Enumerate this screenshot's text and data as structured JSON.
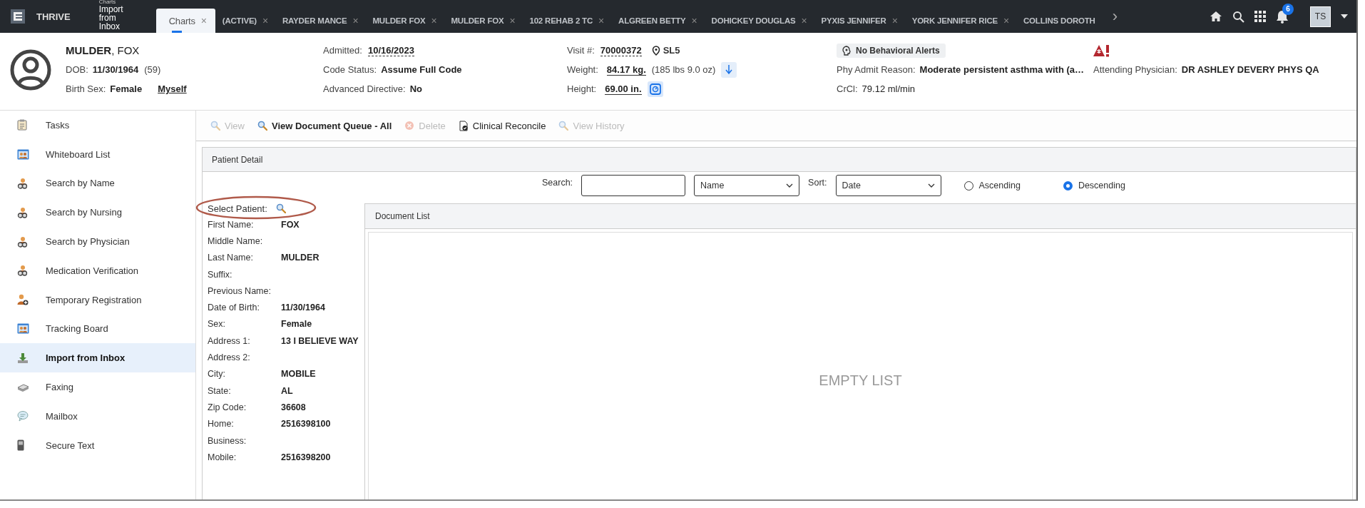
{
  "top_bar": {
    "product": "THRIVE",
    "context_label": "Charts",
    "context_title": "Import from Inbox",
    "tabs": [
      {
        "label": "Charts",
        "selected": true,
        "close": "×"
      },
      {
        "label": "(ACTIVE)",
        "selected": false,
        "close": "×"
      },
      {
        "label": "RAYDER MANCE",
        "selected": false,
        "close": "×"
      },
      {
        "label": "MULDER FOX",
        "selected": false,
        "close": "×"
      },
      {
        "label": "MULDER FOX",
        "selected": false,
        "close": "×"
      },
      {
        "label": "102 REHAB 2 TC",
        "selected": false,
        "close": "×"
      },
      {
        "label": "ALGREEN BETTY",
        "selected": false,
        "close": "×"
      },
      {
        "label": "DOHICKEY DOUGLAS",
        "selected": false,
        "close": "×"
      },
      {
        "label": "PYXIS JENNIFER",
        "selected": false,
        "close": "×"
      },
      {
        "label": "YORK JENNIFER RICE",
        "selected": false,
        "close": "×"
      },
      {
        "label": "COLLINS DOROTH",
        "selected": false
      }
    ],
    "scroll_arrow": "›",
    "notification_count": "6",
    "user_initials": "TS"
  },
  "patient_header": {
    "name": "**MULDER**, FOX",
    "columns": [
      [
        {
          "kind": "field",
          "label": "DOB:",
          "value": "11/30/1964",
          "after": "(59)"
        },
        {
          "kind": "field",
          "label": "Birth Sex:",
          "value": "Female",
          "link": "Myself"
        }
      ],
      [
        {
          "kind": "dotted-field",
          "label": "Admitted:",
          "value": "10/16/2023"
        },
        {
          "kind": "field",
          "label": "Code Status:",
          "value": "Assume Full Code"
        },
        {
          "kind": "field",
          "label": "Advanced Directive:",
          "value": "No"
        }
      ],
      [
        {
          "kind": "dotted-field",
          "label": "Visit #:",
          "value": "70000372",
          "location": "SL5"
        },
        {
          "kind": "trend-field",
          "label": "Weight:",
          "value": "84.17 kg.",
          "after": "(185 lbs 9.0 oz)"
        },
        {
          "kind": "scale-field",
          "label": "Height:",
          "value": "69.00 in."
        }
      ],
      [
        {
          "kind": "chip",
          "text": "No Behavioral Alerts"
        },
        {
          "kind": "field",
          "label": "Phy Admit Reason:",
          "value": "Moderate persistent asthma with (a…"
        },
        {
          "kind": "plain-field",
          "label": "CrCl:",
          "value": "79.12 ml/min"
        }
      ],
      [
        {
          "kind": "alert"
        },
        {
          "kind": "field",
          "label": "Attending Physician:",
          "value": "DR ASHLEY DEVERY PHYS QA"
        }
      ]
    ]
  },
  "sidebar": {
    "items": [
      {
        "label": "Tasks",
        "kind": "clipboard",
        "selected": false
      },
      {
        "label": "Whiteboard List",
        "kind": "board",
        "selected": false
      },
      {
        "label": "Search by Name",
        "kind": "people",
        "selected": false
      },
      {
        "label": "Search by Nursing",
        "kind": "people",
        "selected": false
      },
      {
        "label": "Search by Physician",
        "kind": "people",
        "selected": false
      },
      {
        "label": "Medication Verification",
        "kind": "people",
        "selected": false
      },
      {
        "label": "Temporary Registration",
        "kind": "person-add",
        "selected": false
      },
      {
        "label": "Tracking Board",
        "kind": "board",
        "selected": false
      },
      {
        "label": "Import from Inbox",
        "kind": "download",
        "selected": true
      },
      {
        "label": "Faxing",
        "kind": "fax",
        "selected": false
      },
      {
        "label": "Mailbox",
        "kind": "bubble",
        "selected": false
      },
      {
        "label": "Secure Text",
        "kind": "phone",
        "selected": false
      }
    ]
  },
  "toolbar": {
    "buttons": [
      {
        "label": "View",
        "kind": "search",
        "disabled": true,
        "emphasis": false
      },
      {
        "label": "View Document Queue - All",
        "kind": "search",
        "disabled": false,
        "emphasis": true
      },
      {
        "label": "Delete",
        "kind": "delete",
        "disabled": true,
        "emphasis": false
      },
      {
        "label": "Clinical Reconcile",
        "kind": "document-check",
        "disabled": false,
        "emphasis": false
      },
      {
        "label": "View History",
        "kind": "search",
        "disabled": true,
        "emphasis": false
      }
    ]
  },
  "patient_detail": {
    "title": "Patient Detail",
    "search_label": "Search:",
    "search_by": "Name",
    "sort_label": "Sort:",
    "sort_by": "Date",
    "sort_order": [
      {
        "label": "Ascending",
        "selected": false
      },
      {
        "label": "Descending",
        "selected": true
      }
    ],
    "select_patient": {
      "label": "Select Patient:",
      "circled": true
    },
    "fields": [
      {
        "label": "First Name:",
        "value": "FOX"
      },
      {
        "label": "Middle Name:"
      },
      {
        "label": "Last Name:",
        "value": "MULDER"
      },
      {
        "label": "Suffix:"
      },
      {
        "label": "Previous Name:"
      },
      {
        "label": "Date of Birth:",
        "value": "11/30/1964"
      },
      {
        "label": "Sex:",
        "value": "Female"
      },
      {
        "label": "Address 1:",
        "value": "13 I BELIEVE WAY"
      },
      {
        "label": "Address 2:"
      },
      {
        "label": "City:",
        "value": "MOBILE"
      },
      {
        "label": "State:",
        "value": "AL"
      },
      {
        "label": "Zip Code:",
        "value": "36608"
      },
      {
        "label": "Home:",
        "value": "2516398100"
      },
      {
        "label": "Business:"
      },
      {
        "label": "Mobile:",
        "value": "2516398200"
      }
    ],
    "document_list": {
      "title": "Document List",
      "empty_text": "EMPTY LIST"
    }
  }
}
